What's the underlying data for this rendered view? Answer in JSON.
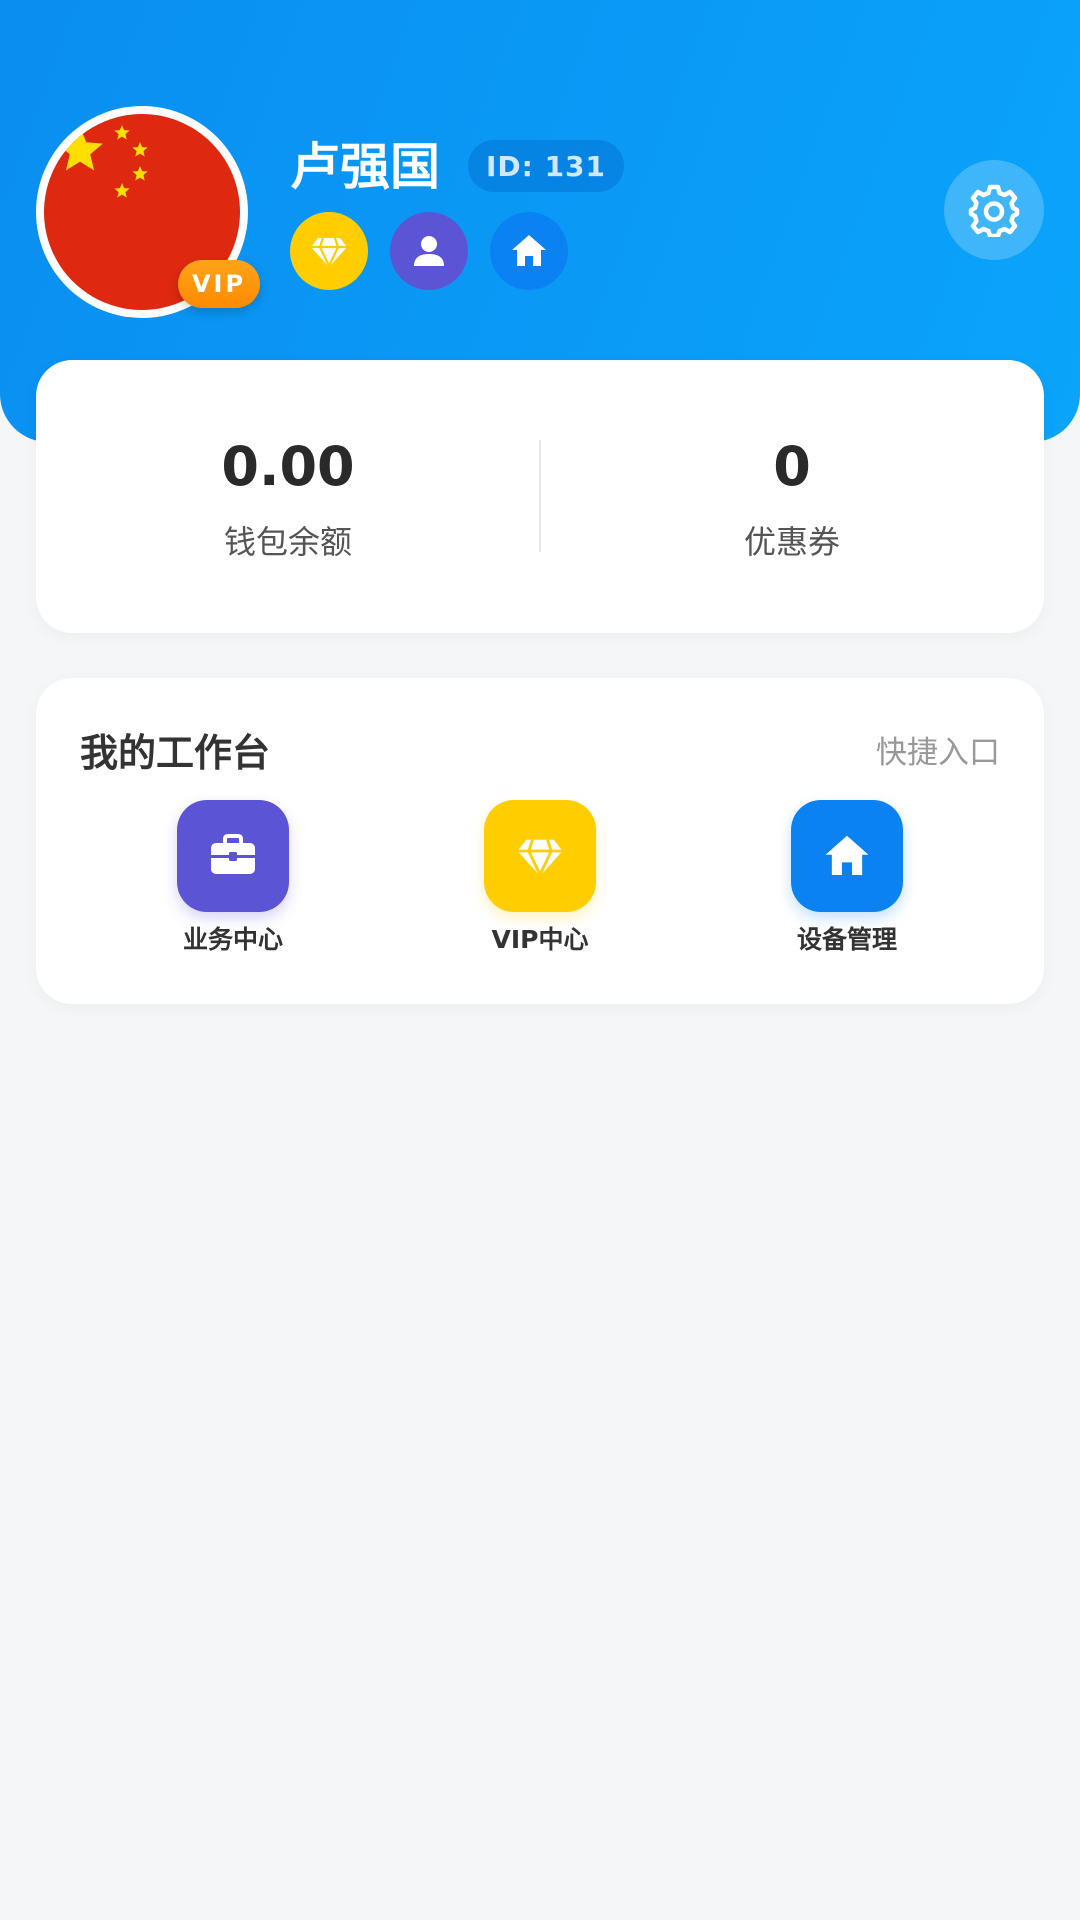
{
  "profile": {
    "name": "卢强国",
    "id_prefix": "ID:",
    "id_value": "131",
    "vip_badge": "VIP",
    "avatar_icon": "china-flag-icon",
    "badges": [
      "diamond-icon",
      "user-icon",
      "home-icon"
    ],
    "settings_icon": "gear-icon"
  },
  "stats": [
    {
      "value": "0.00",
      "label": "钱包余额"
    },
    {
      "value": "0",
      "label": "优惠券"
    }
  ],
  "workbench": {
    "title": "我的工作台",
    "shortcut_label": "快捷入口",
    "items": [
      {
        "label": "业务中心",
        "icon": "briefcase-icon",
        "color": "#5b55d6"
      },
      {
        "label": "VIP中心",
        "icon": "diamond-icon",
        "color": "#ffcd00"
      },
      {
        "label": "设备管理",
        "icon": "home-icon",
        "color": "#0a82f2"
      }
    ]
  },
  "colors": {
    "header_gradient_start": "#0a8ef0",
    "header_gradient_end": "#0aa4fb",
    "vip_orange": "#ff8a00",
    "background": "#f5f6f8"
  }
}
